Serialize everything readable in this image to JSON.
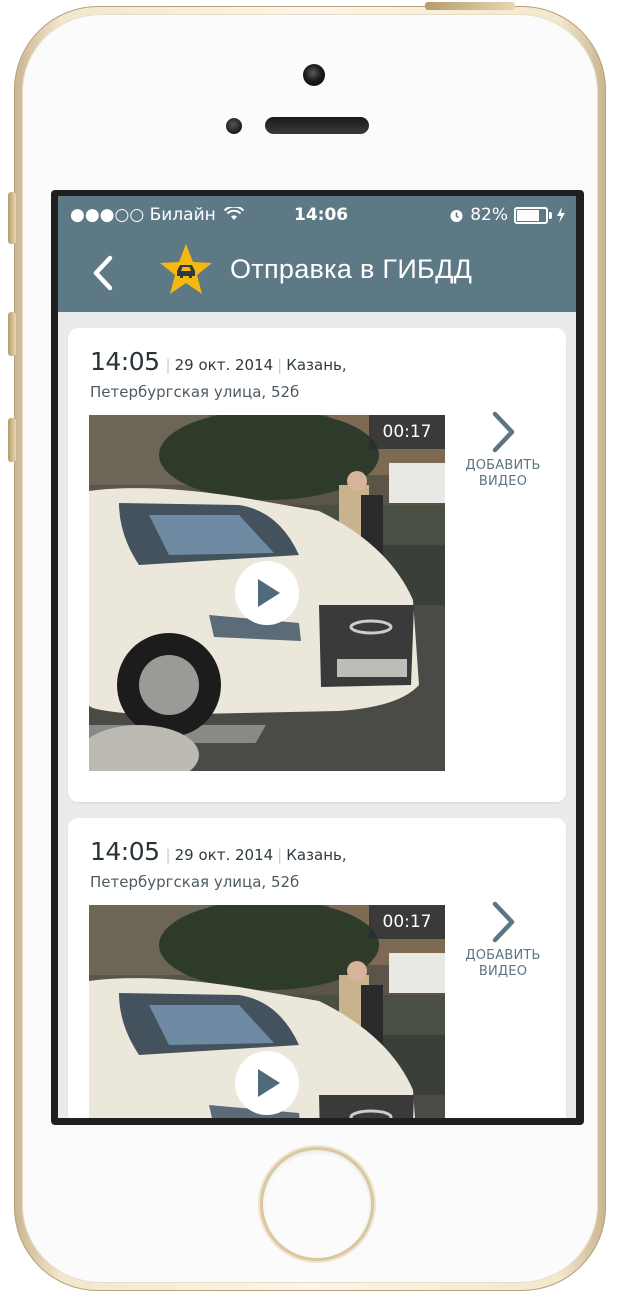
{
  "status_bar": {
    "carrier": "●●●○○ Билайн",
    "time": "14:06",
    "battery": "82%"
  },
  "navbar": {
    "title": "Отправка в ГИБДД",
    "accent_color": "#5e7986",
    "star_color": "#f5b80f",
    "icons": [
      "chevron-left-icon",
      "star-car-icon"
    ]
  },
  "cards": [
    {
      "time": "14:05",
      "date": "29 окт. 2014",
      "city": "Казань,",
      "address": "Петербургская улица, 52б",
      "duration": "00:17",
      "add_label_1": "ДОБАВИТЬ",
      "add_label_2": "ВИДЕО"
    },
    {
      "time": "14:05",
      "date": "29 окт. 2014",
      "city": "Казань,",
      "address": "Петербургская улица, 52б",
      "duration": "00:17",
      "add_label_1": "ДОБАВИТЬ",
      "add_label_2": "ВИДЕО"
    }
  ]
}
